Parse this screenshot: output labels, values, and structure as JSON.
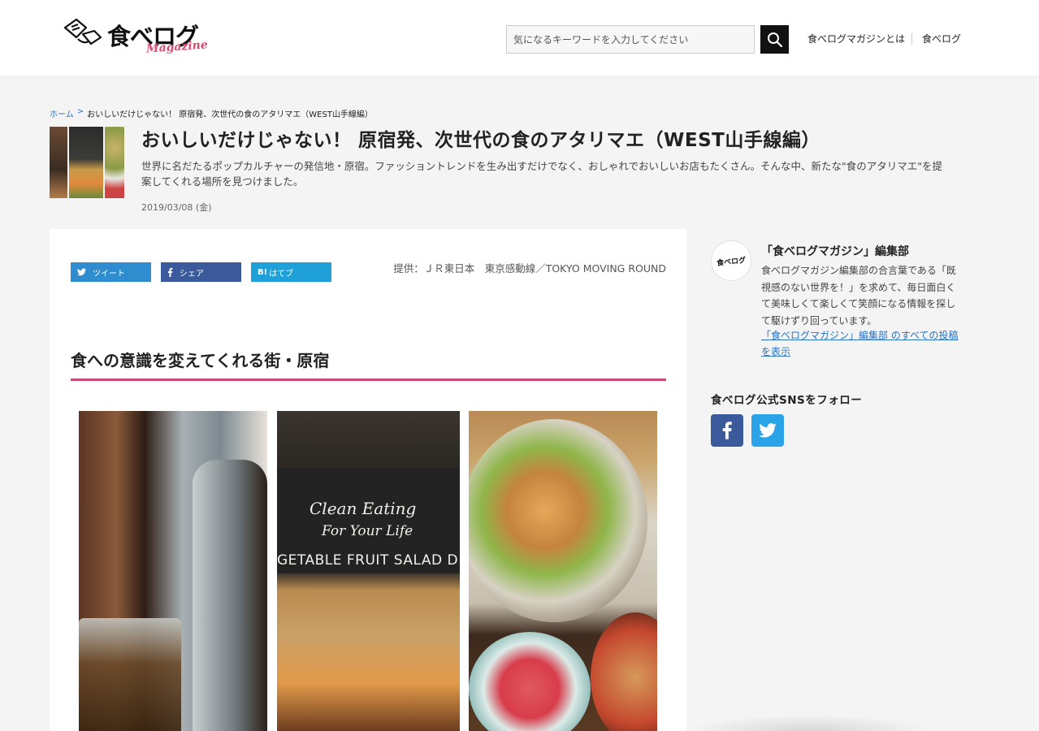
{
  "header": {
    "logo_text": "食べログ",
    "logo_sub": "Magazine",
    "search_placeholder": "気になるキーワードを入力してください",
    "nav": [
      {
        "label": "食べログマガジンとは"
      },
      {
        "label": "食べログ"
      }
    ]
  },
  "breadcrumb": {
    "home": "ホーム",
    "separator": ">",
    "current": "おいしいだけじゃない！ 原宿発、次世代の食のアタリマエ（WEST山手線編）"
  },
  "article": {
    "title": "おいしいだけじゃない！ 原宿発、次世代の食のアタリマエ（WEST山手線編）",
    "lead": "世界に名だたるポップカルチャーの発信地・原宿。ファッショントレンドを生み出すだけでなく、おしゃれでおいしいお店もたくさん。そんな中、新たな\"食のアタリマエ\"を提案してくれる場所を見つけました。",
    "date": "2019/03/08 (金)",
    "share": {
      "tweet": "ツイート",
      "facebook": "シェア",
      "hatena_mark": "B!",
      "hatena": "はてブ"
    },
    "credit": "提供：ＪＲ東日本　東京感動線／TOKYO MOVING ROUND",
    "section_heading": "食への意識を変えてくれる街・原宿",
    "photo_sign": {
      "line1": "Clean Eating",
      "line2": "For Your Life",
      "line3": "GETABLE FRUIT SALAD D"
    }
  },
  "sidebar": {
    "author_avatar_text": "食べログ",
    "author_name": "「食べログマガジン」編集部",
    "author_bio": "食べログマガジン編集部の合言葉である「既視感のない世界を！」を求めて、毎日面白くて美味しくて楽しくて笑顔になる情報を探して駆けずり回っています。",
    "author_link": "「食べログマガジン」編集部 のすべての投稿を表示",
    "sns_title": "食べログ公式SNSをフォロー"
  },
  "colors": {
    "accent": "#c74a78",
    "twitter": "#2f8dcf",
    "facebook": "#3b5a9c",
    "hatena": "#1fa0d8",
    "link": "#2a72c0"
  }
}
